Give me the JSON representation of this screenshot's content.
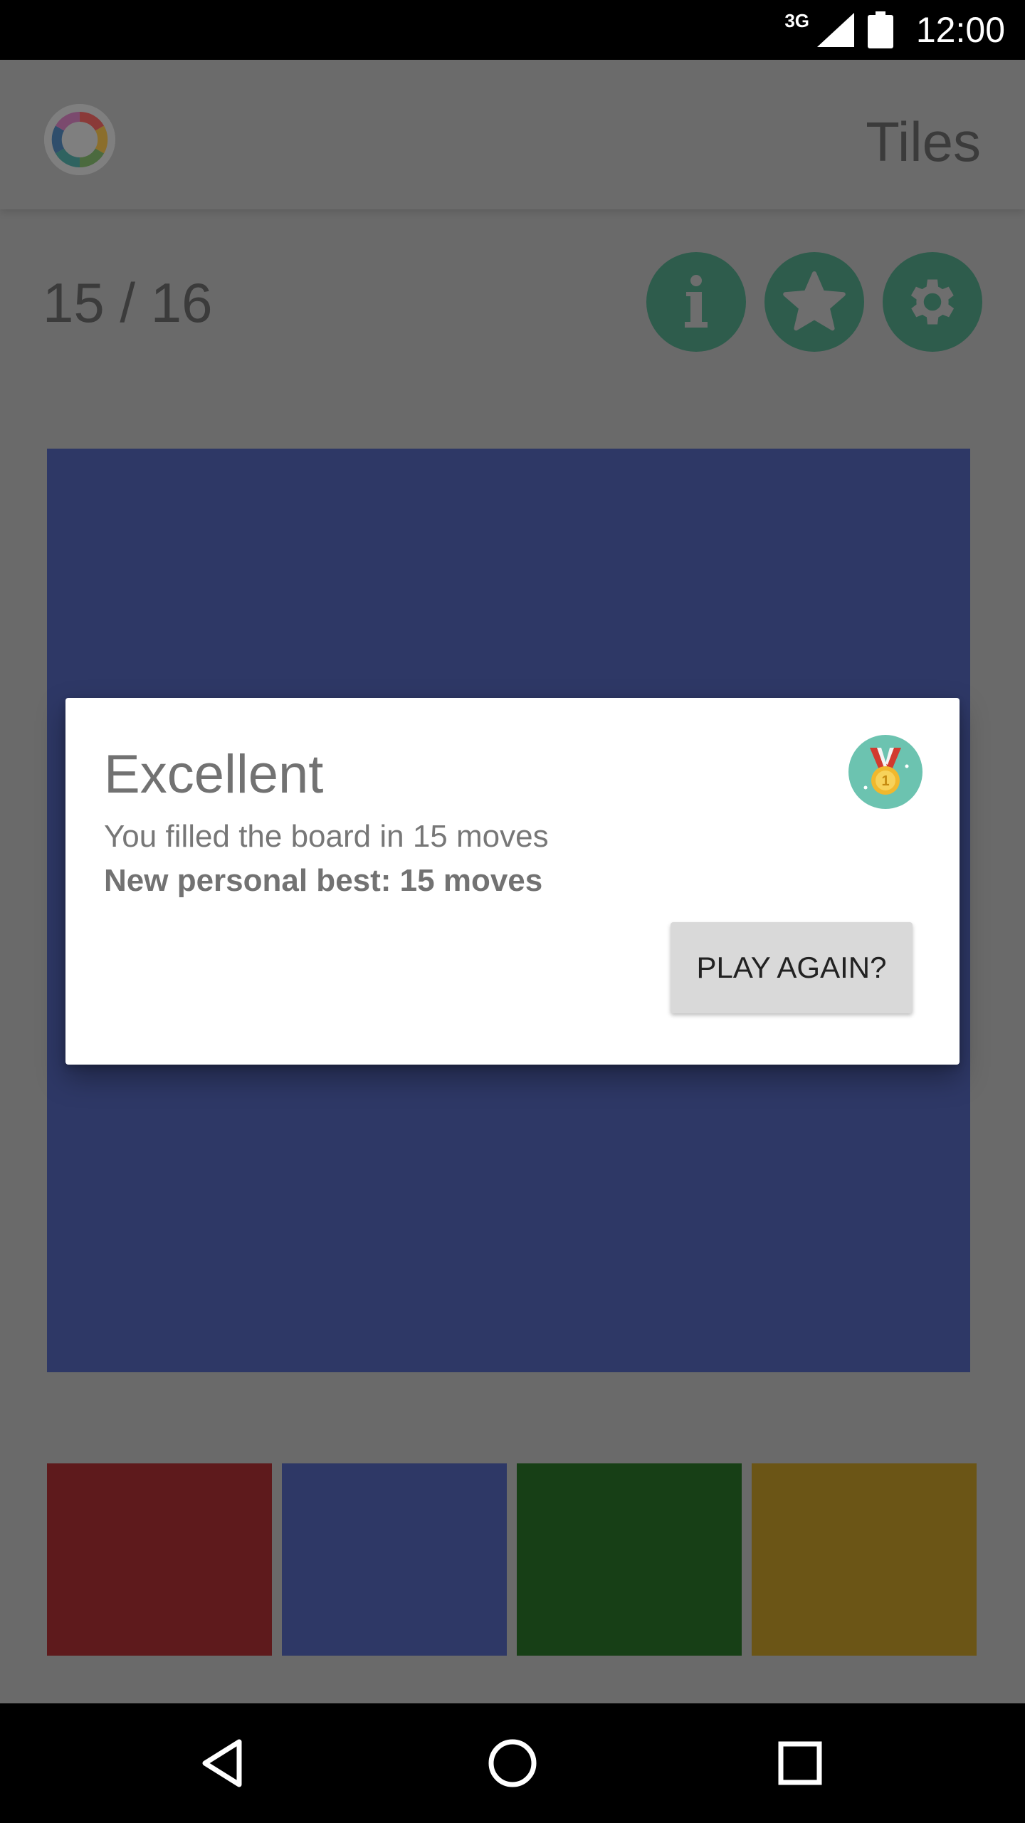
{
  "status_bar": {
    "time": "12:00",
    "network": "3G"
  },
  "app_bar": {
    "title": "Tiles",
    "logo_icon": "color-wheel-icon"
  },
  "game": {
    "move_counter": "15 / 16",
    "actions": [
      {
        "name": "info",
        "icon": "info-icon"
      },
      {
        "name": "achievements",
        "icon": "star-icon"
      },
      {
        "name": "settings",
        "icon": "gear-icon"
      }
    ],
    "board_color": "#2e3866",
    "palette": [
      {
        "name": "red",
        "color": "#5e1a1c"
      },
      {
        "name": "blue",
        "color": "#2e3866"
      },
      {
        "name": "green",
        "color": "#173f16"
      },
      {
        "name": "yellow",
        "color": "#6b5516"
      }
    ]
  },
  "dialog": {
    "title": "Excellent",
    "message": "You filled the board in 15 moves",
    "personal_best": "New personal best: 15 moves",
    "button_label": "PLAY AGAIN?",
    "icon": "gold-medal-icon"
  },
  "nav_bar": {
    "back_icon": "back-triangle-icon",
    "home_icon": "home-circle-icon",
    "recents_icon": "recents-square-icon"
  }
}
